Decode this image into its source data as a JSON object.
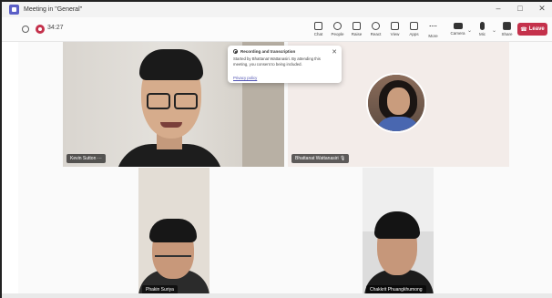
{
  "window": {
    "title": "Meeting in \"General\"",
    "controls": [
      "–",
      "□",
      "✕"
    ]
  },
  "toolbar": {
    "timer": "34:27",
    "tools": [
      {
        "name": "chat",
        "label": "Chat"
      },
      {
        "name": "people",
        "label": "People"
      },
      {
        "name": "raise",
        "label": "Raise"
      },
      {
        "name": "react",
        "label": "React"
      },
      {
        "name": "view",
        "label": "View"
      },
      {
        "name": "apps",
        "label": "Apps"
      },
      {
        "name": "more",
        "label": "More"
      }
    ],
    "camera_label": "Camera",
    "mic_label": "Mic",
    "share_label": "Share",
    "leave_label": "Leave"
  },
  "notification": {
    "title": "Recording and transcription",
    "body": "Started by Bhattanat Wattanasiri. By attending this meeting, you consent to being included.",
    "link": "Privacy policy"
  },
  "participants": [
    {
      "name": "Kevin Sutton"
    },
    {
      "name": "Bhattanat Wattanasiri"
    },
    {
      "name": "Phakin Suriya"
    },
    {
      "name": "Chakkrit Phuangkhumong"
    }
  ],
  "colors": {
    "accent": "#5b5fc7",
    "leave": "#c4314b",
    "recording": "#c4314b"
  }
}
